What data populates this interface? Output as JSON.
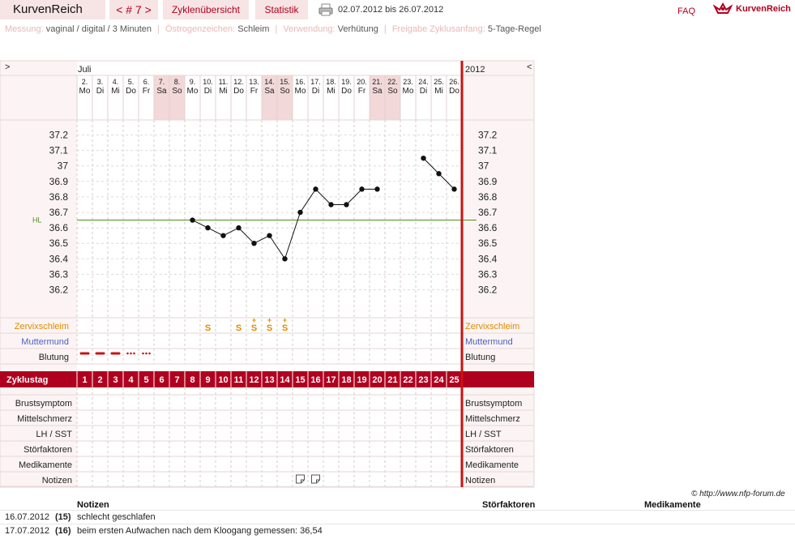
{
  "app": {
    "brand": "KurvenReich",
    "cycle_nav": "< # 7 >",
    "tab_overview": "Zyklenübersicht",
    "tab_stats": "Statistik",
    "date_range": "02.07.2012 bis 26.07.2012",
    "faq": "FAQ",
    "logo_text": "KurvenReich"
  },
  "meta": [
    {
      "label": "Messung:",
      "value": "vaginal / digital / 3 Minuten"
    },
    {
      "label": "Östrogenzeichen:",
      "value": "Schleim"
    },
    {
      "label": "Verwendung:",
      "value": "Verhütung"
    },
    {
      "label": "Freigabe Zyklusanfang:",
      "value": "5-Tage-Regel"
    }
  ],
  "chart": {
    "nav_left": ">",
    "nav_right": "<",
    "month": "Juli",
    "year": "2012",
    "hl_label": "HL",
    "row_labels": {
      "cervix": "Zervixschleim",
      "mm": "Muttermund",
      "blood": "Blutung",
      "cycle": "Zyklustag",
      "breast": "Brustsymptom",
      "mittel": "Mittelschmerz",
      "lh": "LH / SST",
      "stoer": "Störfaktoren",
      "med": "Medikamente",
      "notes": "Notizen"
    },
    "colors": {
      "accent": "#b00020",
      "cervix": "#e08a00",
      "mm": "#4a5fc1",
      "hl": "#4c8f1f",
      "weekend": "#f2d8d8"
    }
  },
  "chart_data": {
    "type": "line",
    "days": [
      {
        "date": "2.",
        "wd": "Mo",
        "weekend": false
      },
      {
        "date": "3.",
        "wd": "Di",
        "weekend": false
      },
      {
        "date": "4.",
        "wd": "Mi",
        "weekend": false
      },
      {
        "date": "5.",
        "wd": "Do",
        "weekend": false
      },
      {
        "date": "6.",
        "wd": "Fr",
        "weekend": false
      },
      {
        "date": "7.",
        "wd": "Sa",
        "weekend": true
      },
      {
        "date": "8.",
        "wd": "So",
        "weekend": true
      },
      {
        "date": "9.",
        "wd": "Mo",
        "weekend": false
      },
      {
        "date": "10.",
        "wd": "Di",
        "weekend": false
      },
      {
        "date": "11.",
        "wd": "Mi",
        "weekend": false
      },
      {
        "date": "12.",
        "wd": "Do",
        "weekend": false
      },
      {
        "date": "13.",
        "wd": "Fr",
        "weekend": false
      },
      {
        "date": "14.",
        "wd": "Sa",
        "weekend": true
      },
      {
        "date": "15.",
        "wd": "So",
        "weekend": true
      },
      {
        "date": "16.",
        "wd": "Mo",
        "weekend": false
      },
      {
        "date": "17.",
        "wd": "Di",
        "weekend": false
      },
      {
        "date": "18.",
        "wd": "Mi",
        "weekend": false
      },
      {
        "date": "19.",
        "wd": "Do",
        "weekend": false
      },
      {
        "date": "20.",
        "wd": "Fr",
        "weekend": false
      },
      {
        "date": "21.",
        "wd": "Sa",
        "weekend": true
      },
      {
        "date": "22.",
        "wd": "So",
        "weekend": true
      },
      {
        "date": "23.",
        "wd": "Mo",
        "weekend": false
      },
      {
        "date": "24.",
        "wd": "Di",
        "weekend": false
      },
      {
        "date": "25.",
        "wd": "Mi",
        "weekend": false
      },
      {
        "date": "26.",
        "wd": "Do",
        "weekend": false
      }
    ],
    "cycle_days": [
      1,
      2,
      3,
      4,
      5,
      6,
      7,
      8,
      9,
      10,
      11,
      12,
      13,
      14,
      15,
      16,
      17,
      18,
      19,
      20,
      21,
      22,
      23,
      24,
      25
    ],
    "series": [
      {
        "points": [
          [
            8,
            36.65
          ],
          [
            9,
            36.6
          ],
          [
            10,
            36.55
          ],
          [
            11,
            36.6
          ],
          [
            12,
            36.5
          ],
          [
            13,
            36.55
          ],
          [
            14,
            36.4
          ],
          [
            15,
            36.7
          ],
          [
            16,
            36.85
          ],
          [
            17,
            36.75
          ],
          [
            18,
            36.75
          ],
          [
            19,
            36.85
          ],
          [
            20,
            36.85
          ]
        ]
      },
      {
        "points": [
          [
            23,
            37.05
          ],
          [
            24,
            36.95
          ],
          [
            25,
            36.85
          ]
        ]
      }
    ],
    "hl_value": 36.65,
    "y_ticks": [
      37.2,
      37.1,
      37.0,
      36.9,
      36.8,
      36.7,
      36.6,
      36.5,
      36.4,
      36.3,
      36.2
    ],
    "y_tick_labels": [
      "37.2",
      "37.1",
      "37",
      "36.9",
      "36.8",
      "36.7",
      "36.6",
      "36.5",
      "36.4",
      "36.3",
      "36.2"
    ],
    "ylim": [
      36.1,
      37.25
    ],
    "cervix": [
      {
        "day": 9,
        "sym": "S"
      },
      {
        "day": 11,
        "sym": "S"
      },
      {
        "day": 12,
        "sym": "S+"
      },
      {
        "day": 13,
        "sym": "S+"
      },
      {
        "day": 14,
        "sym": "S+"
      }
    ],
    "bleeding": [
      {
        "day": 1,
        "kind": "heavy"
      },
      {
        "day": 2,
        "kind": "heavy"
      },
      {
        "day": 3,
        "kind": "heavy"
      },
      {
        "day": 4,
        "kind": "light"
      },
      {
        "day": 5,
        "kind": "light"
      }
    ],
    "notes_days": [
      15,
      16
    ]
  },
  "notes": {
    "headers": {
      "notes": "Notizen",
      "stoer": "Störfaktoren",
      "med": "Medikamente"
    },
    "copyright": "© http://www.nfp-forum.de",
    "rows": [
      {
        "date": "16.07.2012",
        "day": "(15)",
        "text": "schlecht geschlafen"
      },
      {
        "date": "17.07.2012",
        "day": "(16)",
        "text": "beim ersten Aufwachen nach dem Kloogang gemessen: 36,54"
      }
    ]
  }
}
